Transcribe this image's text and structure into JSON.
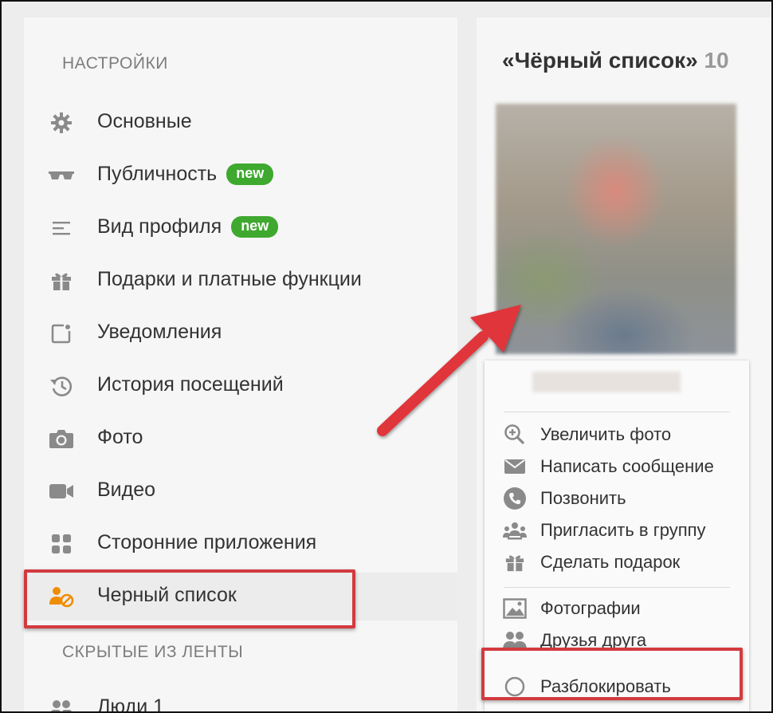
{
  "settings": {
    "section_title": "НАСТРОЙКИ",
    "items": [
      {
        "label": "Основные",
        "icon": "gear-icon"
      },
      {
        "label": "Публичность",
        "icon": "sunglasses-icon",
        "badge": "new"
      },
      {
        "label": "Вид профиля",
        "icon": "lines-icon",
        "badge": "new"
      },
      {
        "label": "Подарки и платные функции",
        "icon": "gift-icon"
      },
      {
        "label": "Уведомления",
        "icon": "notification-icon"
      },
      {
        "label": "История посещений",
        "icon": "history-icon"
      },
      {
        "label": "Фото",
        "icon": "camera-icon"
      },
      {
        "label": "Видео",
        "icon": "video-camera-icon"
      },
      {
        "label": "Сторонние приложения",
        "icon": "apps-grid-icon"
      },
      {
        "label": "Черный список",
        "icon": "blocked-user-icon",
        "active": true
      }
    ],
    "hidden_section_title": "СКРЫТЫЕ ИЗ ЛЕНТЫ",
    "hidden_items": [
      {
        "label": "Люди 1",
        "icon": "people-icon"
      }
    ]
  },
  "blacklist": {
    "title": "«Чёрный список»",
    "count": "10",
    "actions_group1": [
      {
        "label": "Увеличить фото",
        "icon": "zoom-in-icon"
      },
      {
        "label": "Написать сообщение",
        "icon": "envelope-icon"
      },
      {
        "label": "Позвонить",
        "icon": "phone-icon"
      },
      {
        "label": "Пригласить в группу",
        "icon": "group-invite-icon"
      },
      {
        "label": "Сделать подарок",
        "icon": "gift-icon"
      }
    ],
    "actions_group2": [
      {
        "label": "Фотографии",
        "icon": "photos-icon"
      },
      {
        "label": "Друзья друга",
        "icon": "friends-icon"
      }
    ],
    "unblock": {
      "label": "Разблокировать",
      "icon": "circle-icon"
    }
  },
  "colors": {
    "badge": "#3fa82f",
    "highlight": "#d23a3f",
    "blocked_icon": "#f08c00",
    "icon_gray": "#8a8a8a"
  }
}
